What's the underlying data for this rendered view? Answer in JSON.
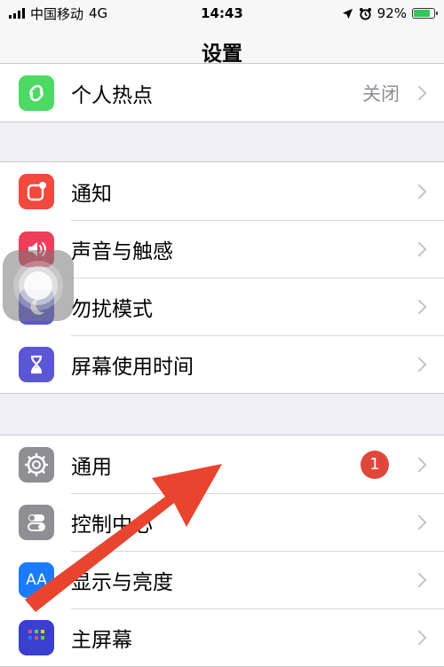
{
  "status_bar": {
    "carrier": "中国移动",
    "network": "4G",
    "time": "14:43",
    "battery_percent": "92%",
    "battery_level": 0.92
  },
  "nav": {
    "title": "设置"
  },
  "rows": {
    "hotspot": {
      "label": "个人热点",
      "detail": "关闭"
    },
    "notifications": {
      "label": "通知"
    },
    "sounds": {
      "label": "声音与触感"
    },
    "dnd": {
      "label": "勿扰模式"
    },
    "screen_time": {
      "label": "屏幕使用时间"
    },
    "general": {
      "label": "通用",
      "badge": "1"
    },
    "control_center": {
      "label": "控制中心"
    },
    "display": {
      "label": "显示与亮度",
      "icon_text": "AA"
    },
    "home_screen": {
      "label": "主屏幕"
    }
  },
  "colors": {
    "hotspot": "#4cd964",
    "notifications": "#f0493e",
    "sounds": "#ee3f5a",
    "dnd": "#5a56d6",
    "screen_time": "#5a56d6",
    "general": "#8e8e93",
    "control_center": "#8e8e93",
    "display": "#1a7bff",
    "arrow": "#e8442e"
  }
}
